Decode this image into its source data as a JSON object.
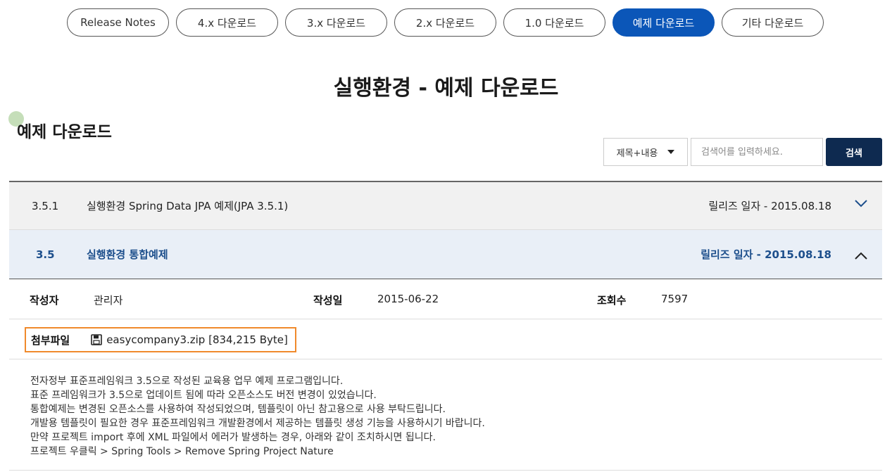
{
  "tabs": [
    {
      "label": "Release Notes",
      "active": false
    },
    {
      "label": "4.x 다운로드",
      "active": false
    },
    {
      "label": "3.x 다운로드",
      "active": false
    },
    {
      "label": "2.x 다운로드",
      "active": false
    },
    {
      "label": "1.0 다운로드",
      "active": false
    },
    {
      "label": "예제 다운로드",
      "active": true
    },
    {
      "label": "기타 다운로드",
      "active": false
    }
  ],
  "page_title": "실행환경 - 예제 다운로드",
  "section_title": "예제 다운로드",
  "search": {
    "select_value": "제목+내용",
    "placeholder": "검색어를 입력하세요.",
    "button_label": "검색"
  },
  "rows": [
    {
      "version": "3.5.1",
      "title": "실행환경 Spring Data JPA 예제(JPA 3.5.1)",
      "release": "릴리즈 일자 - 2015.08.18",
      "expanded": false
    },
    {
      "version": "3.5",
      "title": "실행환경 통합예제",
      "release": "릴리즈 일자 - 2015.08.18",
      "expanded": true
    }
  ],
  "detail": {
    "author_label": "작성자",
    "author": "관리자",
    "date_label": "작성일",
    "date": "2015-06-22",
    "views_label": "조회수",
    "views": "7597",
    "attach_label": "첨부파일",
    "attach_file": "easycompany3.zip [834,215 Byte]",
    "description": [
      "전자정부 표준프레임워크 3.5으로 작성된 교육용 업무 예제 프로그램입니다.",
      "표준 프레임워크가 3.5으로 업데이트 됨에 따라 오픈소스도 버전 변경이 있었습니다.",
      "통합예제는 변경된 오픈소스를 사용하여 작성되었으며, 템플릿이 아닌 참고용으로 사용 부탁드립니다.",
      "개발용 템플릿이 필요한 경우 표준프레임워크 개발환경에서 제공하는 템플릿 생성 기능을 사용하시기 바랍니다.",
      "만약 프로젝트 import 후에 XML 파일에서 에러가 발생하는 경우, 아래와 같이 조치하시면 됩니다.",
      "프로젝트 우클릭 > Spring Tools > Remove Spring Project Nature"
    ]
  },
  "colors": {
    "active_tab": "#0b56b8",
    "search_button": "#0e2a50",
    "attach_highlight": "#f08a2c",
    "expanded_row_text": "#1d4f8c"
  },
  "icons": {
    "row_collapsed": "chevron-down-icon",
    "row_expanded": "chevron-up-icon",
    "attachment": "floppy-disk-icon"
  }
}
